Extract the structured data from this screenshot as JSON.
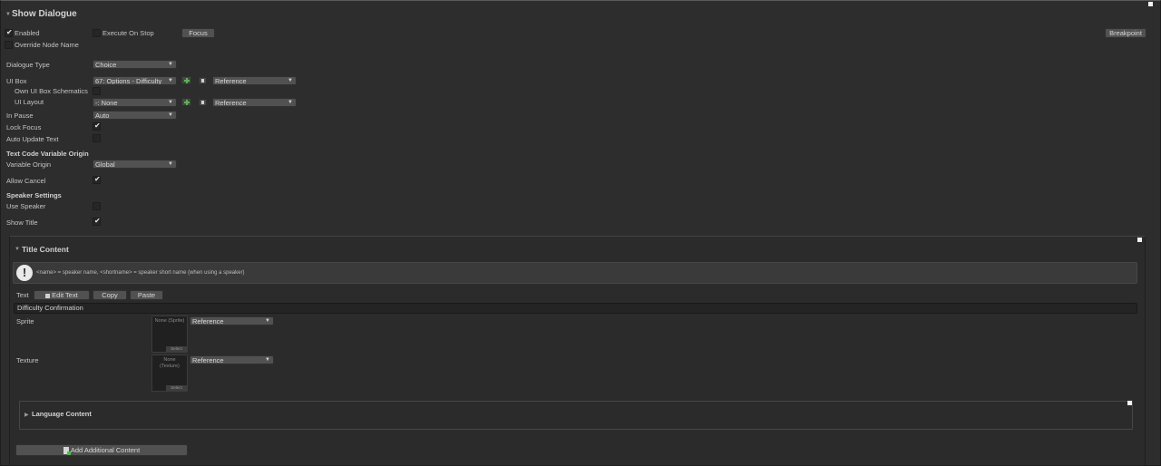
{
  "header": {
    "title": "Show Dialogue"
  },
  "top_row": {
    "enabled_label": "Enabled",
    "enabled_checked": true,
    "execute_on_stop_label": "Execute On Stop",
    "execute_on_stop_checked": false,
    "focus_button": "Focus",
    "breakpoint_button": "Breakpoint",
    "override_node_name_label": "Override Node Name",
    "override_node_name_checked": false
  },
  "fields": {
    "dialogue_type": {
      "label": "Dialogue Type",
      "value": "Choice"
    },
    "ui_box": {
      "label": "UI Box",
      "value": "67: Options - Difficulty",
      "mode": "Reference"
    },
    "own_ui_box_schematics": {
      "label": "Own UI Box Schematics",
      "checked": false
    },
    "ui_layout": {
      "label": "UI Layout",
      "value": "-: None",
      "mode": "Reference"
    },
    "in_pause": {
      "label": "In Pause",
      "value": "Auto"
    },
    "lock_focus": {
      "label": "Lock Focus",
      "checked": true
    },
    "auto_update_text": {
      "label": "Auto Update Text",
      "checked": false
    },
    "text_code_section": "Text Code Variable Origin",
    "variable_origin": {
      "label": "Variable Origin",
      "value": "Global"
    },
    "allow_cancel": {
      "label": "Allow Cancel",
      "checked": true
    },
    "speaker_section": "Speaker Settings",
    "use_speaker": {
      "label": "Use Speaker",
      "checked": false
    },
    "show_title": {
      "label": "Show Title",
      "checked": true
    }
  },
  "title_content": {
    "heading": "Title Content",
    "help_text": "<name> = speaker name, <shortname> = speaker short name (when using a speaker)",
    "text_label": "Text",
    "edit_text_button": "Edit Text",
    "copy_button": "Copy",
    "paste_button": "Paste",
    "text_value": "Difficulty Confirmation",
    "sprite": {
      "label": "Sprite",
      "field_text": "None (Sprite)",
      "select": "Select",
      "mode": "Reference"
    },
    "texture": {
      "label": "Texture",
      "field_text": "None\n(Texture)",
      "select": "Select",
      "mode": "Reference"
    },
    "language_content": "Language Content",
    "add_additional_content": "Add Additional Content"
  },
  "colors": {
    "background": "#2d2d2d",
    "accent_green": "#48c040",
    "text": "#c8c8c8"
  },
  "icons": [
    "foldout-triangle-icon",
    "checkmark-icon",
    "dropdown-arrow-icon",
    "add-green-plus-icon",
    "square-small-icon",
    "warning-exclamation-icon",
    "edit-text-icon",
    "add-content-icon"
  ]
}
